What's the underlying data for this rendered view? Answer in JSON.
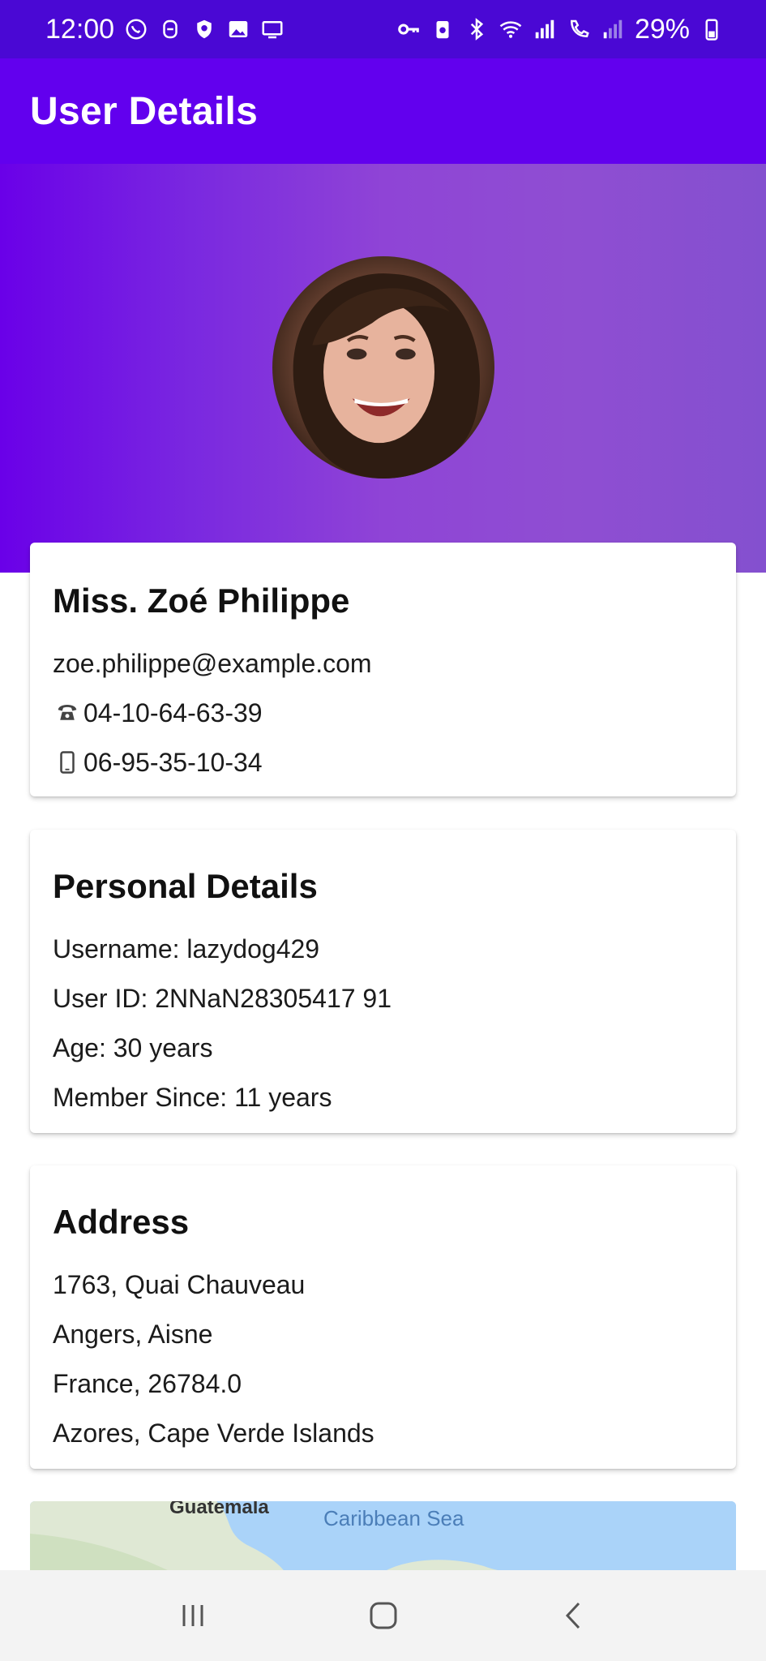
{
  "status_bar": {
    "time": "12:00",
    "battery": "29%",
    "icons_left": [
      "whatsapp-icon",
      "face-icon",
      "shield-icon",
      "image-icon",
      "cast-icon"
    ],
    "icons_right": [
      "vpn-key-icon",
      "battery-saver-icon",
      "bluetooth-icon",
      "wifi-icon",
      "signal-icon",
      "wifi-calling-icon",
      "signal-weak-icon",
      "battery-icon"
    ]
  },
  "app_bar": {
    "title": "User Details"
  },
  "colors": {
    "status_bar": "#4a08d4",
    "app_bar": "#6200ee",
    "hero_start": "#6a00e8",
    "hero_end": "#8450cf"
  },
  "contact": {
    "name": "Miss. Zoé Philippe",
    "email": "zoe.philippe@example.com",
    "phone_icon": "☎",
    "phone": "04-10-64-63-39",
    "cell": "06-95-35-10-34"
  },
  "personal": {
    "title": "Personal Details",
    "username": "Username: lazydog429",
    "user_id": "User ID: 2NNaN28305417 91",
    "age": "Age: 30 years",
    "member_since": "Member Since: 11 years"
  },
  "address": {
    "title": "Address",
    "street": "1763, Quai Chauveau",
    "city_state": "Angers, Aisne",
    "country_postcode": "France, 26784.0",
    "timezone": "Azores, Cape Verde Islands"
  },
  "map": {
    "label_1": "Guatemala",
    "label_2": "Caribbean Sea"
  }
}
